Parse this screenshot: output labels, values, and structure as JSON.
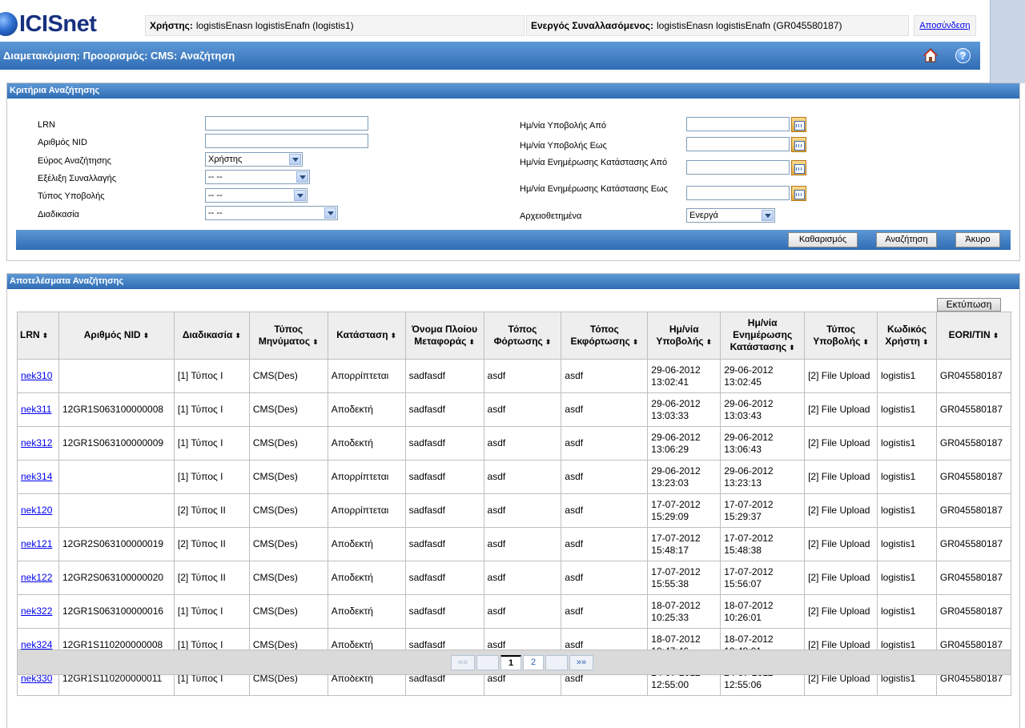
{
  "header": {
    "logo_text": "ICISnet",
    "user_label": "Χρήστης:",
    "user_value": "logistisEnasn logistisEnafn (logistis1)",
    "trader_label": "Ενεργός Συναλλασόμενος:",
    "trader_value": "logistisEnasn logistisEnafn (GR045580187)",
    "logout_label": "Αποσύνδεση",
    "page_title": "Διαμετακόμιση: Προορισμός: CMS: Αναζήτηση",
    "help_symbol": "?"
  },
  "criteria": {
    "title": "Κριτήρια Αναζήτησης",
    "lrn_label": "LRN",
    "lrn_value": "",
    "nid_label": "Αριθμός NID",
    "nid_value": "",
    "range_label": "Εύρος Αναζήτησης",
    "range_value": "Χρήστης",
    "evolution_label": "Εξέλιξη Συναλλαγής",
    "evolution_value": "-- --",
    "submission_type_label": "Τύπος Υποβολής",
    "submission_type_value": "-- --",
    "procedure_label": "Διαδικασία",
    "procedure_value": "-- --",
    "submit_from_label": "Ημ/νία Υποβολής Από",
    "submit_from_value": "",
    "submit_to_label": "Ημ/νία Υποβολής Εως",
    "submit_to_value": "",
    "status_from_label": "Ημ/νία Ενημέρωσης Κατάστασης Από",
    "status_from_value": "",
    "status_to_label": "Ημ/νία Ενημέρωσης Κατάστασης Εως",
    "status_to_value": "",
    "archived_label": "Αρχειοθετημένα",
    "archived_value": "Ενεργά",
    "clear_button": "Καθαρισμός",
    "search_button": "Αναζήτηση",
    "cancel_button": "Άκυρο"
  },
  "results": {
    "title": "Αποτελέσματα Αναζήτησης",
    "print_button": "Εκτύπωση",
    "sort_symbol": "⬍",
    "columns": [
      "LRN",
      "Αριθμός NID",
      "Διαδικασία",
      "Τύπος Μηνύματος",
      "Κατάσταση",
      "Όνομα Πλοίου Μεταφοράς",
      "Τόπος Φόρτωσης",
      "Τόπος Εκφόρτωσης",
      "Ημ/νία Υποβολής",
      "Ημ/νία Ενημέρωσης Κατάστασης",
      "Τύπος Υποβολής",
      "Κωδικός Χρήστη",
      "EORI/TIN"
    ],
    "rows": [
      [
        "nek310",
        "",
        "[1] Τύπος I",
        "CMS(Des)",
        "Απορρίπτεται",
        "sadfasdf",
        "asdf",
        "asdf",
        "29-06-2012 13:02:41",
        "29-06-2012 13:02:45",
        "[2] File Upload",
        "logistis1",
        "GR045580187"
      ],
      [
        "nek311",
        "12GR1S063100000008",
        "[1] Τύπος I",
        "CMS(Des)",
        "Αποδεκτή",
        "sadfasdf",
        "asdf",
        "asdf",
        "29-06-2012 13:03:33",
        "29-06-2012 13:03:43",
        "[2] File Upload",
        "logistis1",
        "GR045580187"
      ],
      [
        "nek312",
        "12GR1S063100000009",
        "[1] Τύπος I",
        "CMS(Des)",
        "Αποδεκτή",
        "sadfasdf",
        "asdf",
        "asdf",
        "29-06-2012 13:06:29",
        "29-06-2012 13:06:43",
        "[2] File Upload",
        "logistis1",
        "GR045580187"
      ],
      [
        "nek314",
        "",
        "[1] Τύπος I",
        "CMS(Des)",
        "Απορρίπτεται",
        "sadfasdf",
        "asdf",
        "asdf",
        "29-06-2012 13:23:03",
        "29-06-2012 13:23:13",
        "[2] File Upload",
        "logistis1",
        "GR045580187"
      ],
      [
        "nek120",
        "",
        "[2] Τύπος II",
        "CMS(Des)",
        "Απορρίπτεται",
        "sadfasdf",
        "asdf",
        "asdf",
        "17-07-2012 15:29:09",
        "17-07-2012 15:29:37",
        "[2] File Upload",
        "logistis1",
        "GR045580187"
      ],
      [
        "nek121",
        "12GR2S063100000019",
        "[2] Τύπος II",
        "CMS(Des)",
        "Αποδεκτή",
        "sadfasdf",
        "asdf",
        "asdf",
        "17-07-2012 15:48:17",
        "17-07-2012 15:48:38",
        "[2] File Upload",
        "logistis1",
        "GR045580187"
      ],
      [
        "nek122",
        "12GR2S063100000020",
        "[2] Τύπος II",
        "CMS(Des)",
        "Αποδεκτή",
        "sadfasdf",
        "asdf",
        "asdf",
        "17-07-2012 15:55:38",
        "17-07-2012 15:56:07",
        "[2] File Upload",
        "logistis1",
        "GR045580187"
      ],
      [
        "nek322",
        "12GR1S063100000016",
        "[1] Τύπος I",
        "CMS(Des)",
        "Αποδεκτή",
        "sadfasdf",
        "asdf",
        "asdf",
        "18-07-2012 10:25:33",
        "18-07-2012 10:26:01",
        "[2] File Upload",
        "logistis1",
        "GR045580187"
      ],
      [
        "nek324",
        "12GR1S110200000008",
        "[1] Τύπος I",
        "CMS(Des)",
        "Αποδεκτή",
        "sadfasdf",
        "asdf",
        "asdf",
        "18-07-2012 10:47:46",
        "18-07-2012 10:48:01",
        "[2] File Upload",
        "logistis1",
        "GR045580187"
      ],
      [
        "nek330",
        "12GR1S110200000011",
        "[1] Τύπος I",
        "CMS(Des)",
        "Αποδεκτή",
        "sadfasdf",
        "asdf",
        "asdf",
        "24-07-2012 12:55:00",
        "24-07-2012 12:55:06",
        "[2] File Upload",
        "logistis1",
        "GR045580187"
      ]
    ],
    "pager": {
      "first": "««",
      "last": "»»",
      "current": "1",
      "next_page": "2"
    }
  },
  "colors": {
    "bar_blue": "#2f6cb3",
    "link": "#0000ee"
  }
}
